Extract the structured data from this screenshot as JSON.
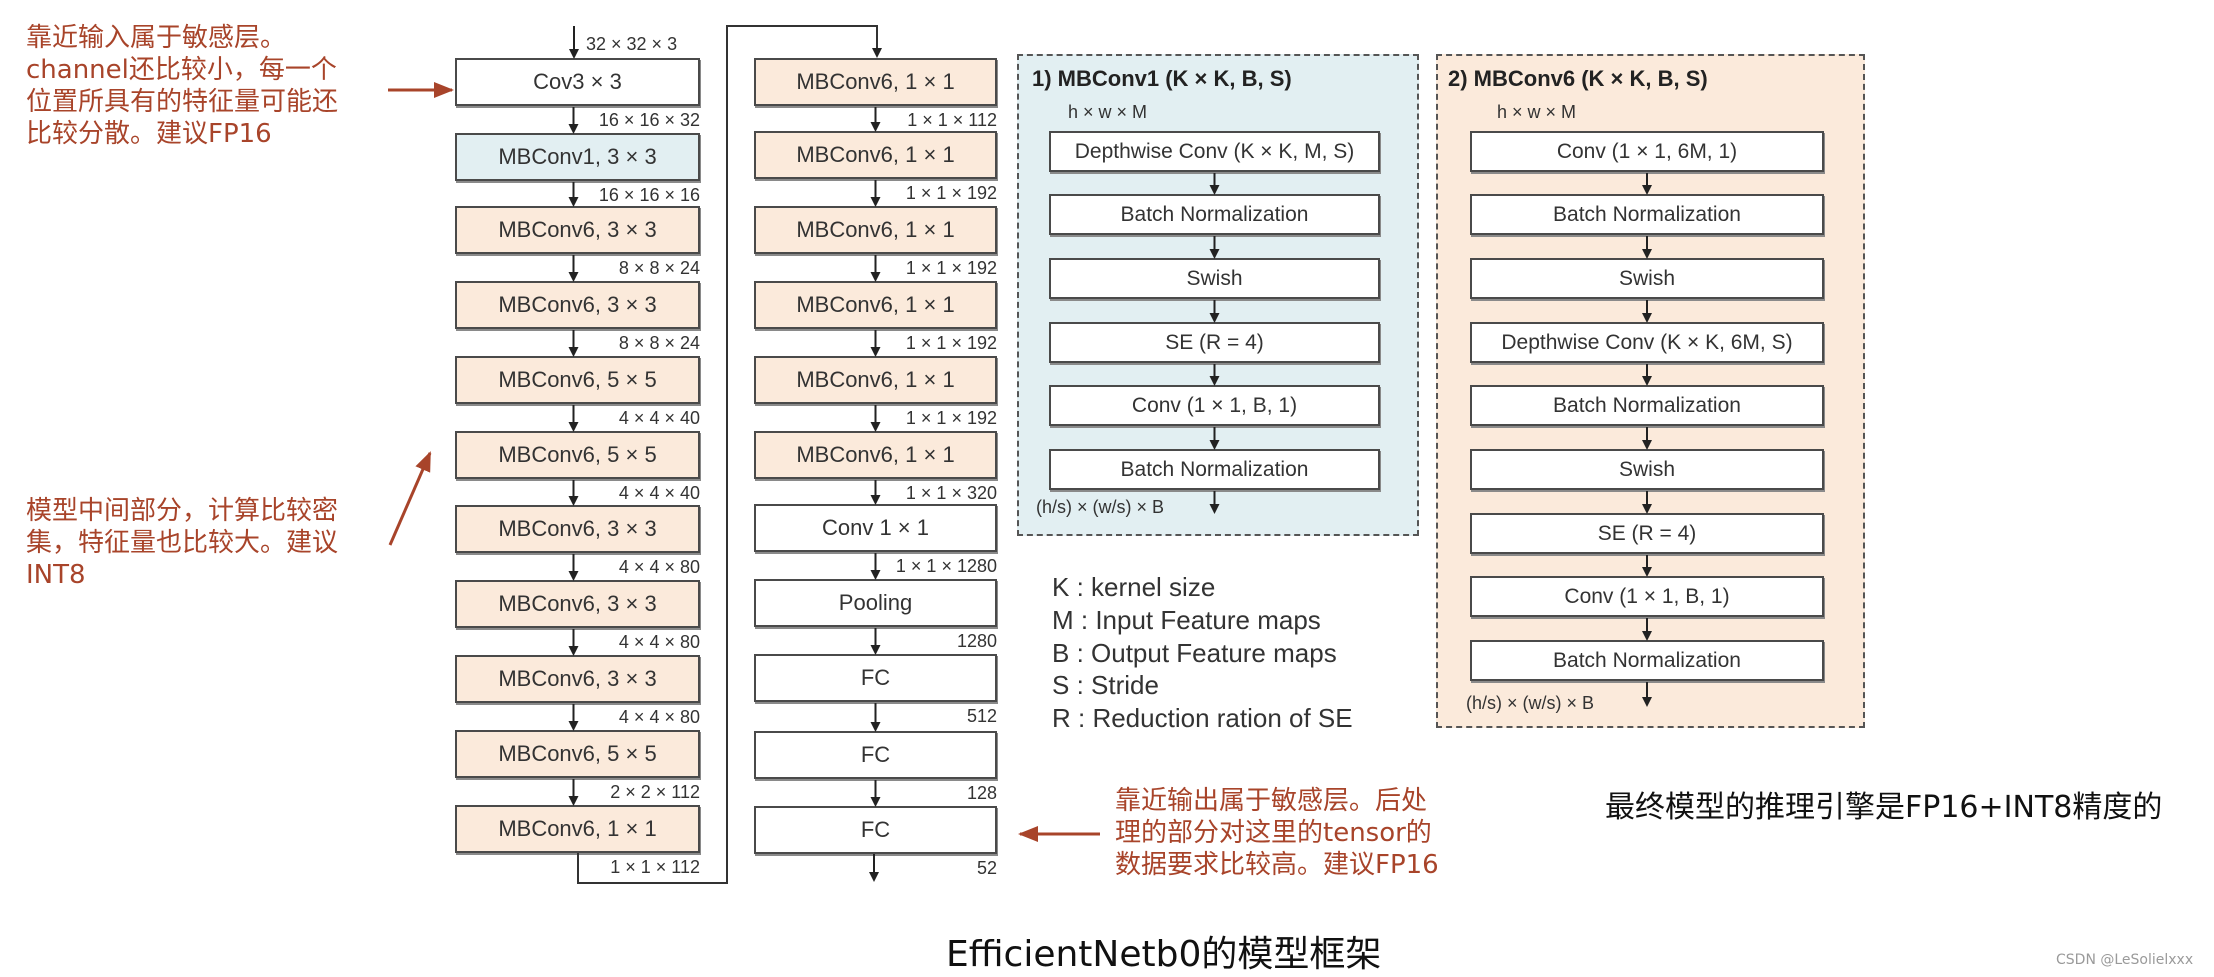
{
  "notes": {
    "input_sensitive": [
      "靠近输入属于敏感层。",
      "channel还比较小，每一个",
      "位置所具有的特征量可能还",
      "比较分散。建议FP16"
    ],
    "middle_part": [
      "模型中间部分，计算比较密",
      "集，特征量也比较大。建议",
      "INT8"
    ],
    "output_sensitive": [
      "靠近输出属于敏感层。后处",
      "理的部分对这里的tensor的",
      "数据要求比较高。建议FP16"
    ],
    "conclusion": "最终模型的推理引擎是FP16+INT8精度的",
    "accent_color": "#a8442a"
  },
  "left_column": {
    "input_dim": "32 × 32 × 3",
    "blocks": [
      {
        "label": "Cov3 × 3",
        "type": "conv",
        "out_dim": "16 × 16 × 32"
      },
      {
        "label": "MBConv1, 3 × 3",
        "type": "mbconv1",
        "out_dim": "16 × 16 × 16"
      },
      {
        "label": "MBConv6, 3 × 3",
        "type": "mbconv6",
        "out_dim": "8 × 8 × 24"
      },
      {
        "label": "MBConv6, 3 × 3",
        "type": "mbconv6",
        "out_dim": "8 × 8 × 24"
      },
      {
        "label": "MBConv6, 5 × 5",
        "type": "mbconv6",
        "out_dim": "4 × 4 × 40"
      },
      {
        "label": "MBConv6, 5 × 5",
        "type": "mbconv6",
        "out_dim": "4 × 4 × 40"
      },
      {
        "label": "MBConv6, 3 × 3",
        "type": "mbconv6",
        "out_dim": "4 × 4 × 80"
      },
      {
        "label": "MBConv6, 3 × 3",
        "type": "mbconv6",
        "out_dim": "4 × 4 × 80"
      },
      {
        "label": "MBConv6, 3 × 3",
        "type": "mbconv6",
        "out_dim": "4 × 4 × 80"
      },
      {
        "label": "MBConv6, 5 × 5",
        "type": "mbconv6",
        "out_dim": "2 × 2 × 112"
      },
      {
        "label": "MBConv6, 1 × 1",
        "type": "mbconv6",
        "out_dim": "1 × 1 × 112"
      }
    ]
  },
  "middle_column": {
    "blocks": [
      {
        "label": "MBConv6, 1 × 1",
        "type": "mbconv6",
        "out_dim": "1 × 1 × 112"
      },
      {
        "label": "MBConv6, 1 × 1",
        "type": "mbconv6",
        "out_dim": "1 × 1 × 192"
      },
      {
        "label": "MBConv6, 1 × 1",
        "type": "mbconv6",
        "out_dim": "1 × 1 × 192"
      },
      {
        "label": "MBConv6, 1 × 1",
        "type": "mbconv6",
        "out_dim": "1 × 1 × 192"
      },
      {
        "label": "MBConv6, 1 × 1",
        "type": "mbconv6",
        "out_dim": "1 × 1 × 192"
      },
      {
        "label": "MBConv6, 1 × 1",
        "type": "mbconv6",
        "out_dim": "1 × 1 × 320"
      },
      {
        "label": "Conv 1 × 1",
        "type": "conv",
        "out_dim": "1 × 1 × 1280"
      },
      {
        "label": "Pooling",
        "type": "conv",
        "out_dim": "1280"
      },
      {
        "label": "FC",
        "type": "conv",
        "out_dim": "512"
      },
      {
        "label": "FC",
        "type": "conv",
        "out_dim": "128"
      },
      {
        "label": "FC",
        "type": "conv",
        "out_dim": "52"
      }
    ]
  },
  "mbconv1_panel": {
    "title": "1) MBConv1 (K × K, B, S)",
    "input": "h × w × M",
    "layers": [
      "Depthwise Conv (K × K, M, S)",
      "Batch Normalization",
      "Swish",
      "SE (R = 4)",
      "Conv (1 × 1, B, 1)",
      "Batch Normalization"
    ],
    "output": "(h/s) × (w/s) × B",
    "bg_color": "#e2eff2"
  },
  "mbconv6_panel": {
    "title": "2) MBConv6 (K × K, B, S)",
    "input": "h × w × M",
    "layers": [
      "Conv (1 × 1, 6M, 1)",
      "Batch Normalization",
      "Swish",
      "Depthwise Conv (K × K, 6M, S)",
      "Batch Normalization",
      "Swish",
      "SE (R = 4)",
      "Conv (1 × 1, B, 1)",
      "Batch Normalization"
    ],
    "output": "(h/s) × (w/s) × B",
    "bg_color": "#fbeadb"
  },
  "legend": [
    "K : kernel size",
    "M : Input Feature maps",
    "B : Output Feature maps",
    "S : Stride",
    "R : Reduction ration of SE"
  ],
  "caption": "EfficientNetb0的模型框架",
  "watermark": "CSDN @LeSolielxxx"
}
